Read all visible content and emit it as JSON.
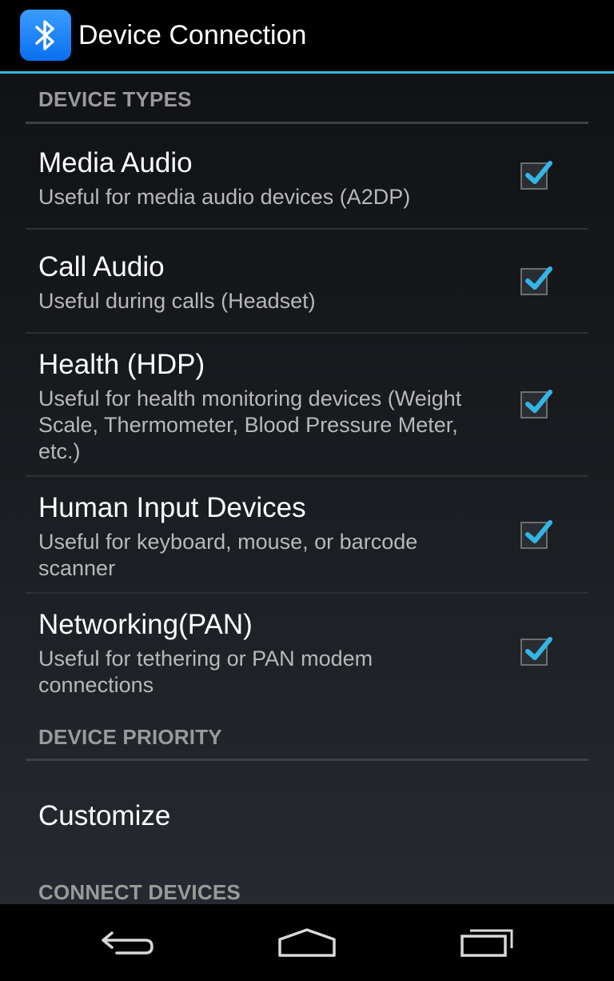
{
  "app": {
    "title": "Device Connection",
    "icon": "bluetooth-icon",
    "accent_color": "#33b5e5"
  },
  "sections": {
    "device_types": {
      "header": "DEVICE TYPES",
      "items": [
        {
          "title": "Media Audio",
          "summary": "Useful for media audio devices (A2DP)",
          "checked": true
        },
        {
          "title": "Call Audio",
          "summary": "Useful during calls (Headset)",
          "checked": true
        },
        {
          "title": "Health (HDP)",
          "summary": "Useful for health monitoring devices (Weight Scale, Thermometer, Blood Pressure Meter, etc.)",
          "checked": true
        },
        {
          "title": "Human Input Devices",
          "summary": "Useful for keyboard, mouse, or barcode scanner",
          "checked": true
        },
        {
          "title": "Networking(PAN)",
          "summary": "Useful for tethering or PAN modem connections",
          "checked": true
        }
      ]
    },
    "device_priority": {
      "header": "DEVICE PRIORITY",
      "items": [
        {
          "title": "Customize"
        }
      ]
    },
    "connect_devices": {
      "header": "CONNECT DEVICES"
    }
  },
  "nav": {
    "back_icon": "back-icon",
    "home_icon": "home-icon",
    "recents_icon": "recent-apps-icon"
  }
}
